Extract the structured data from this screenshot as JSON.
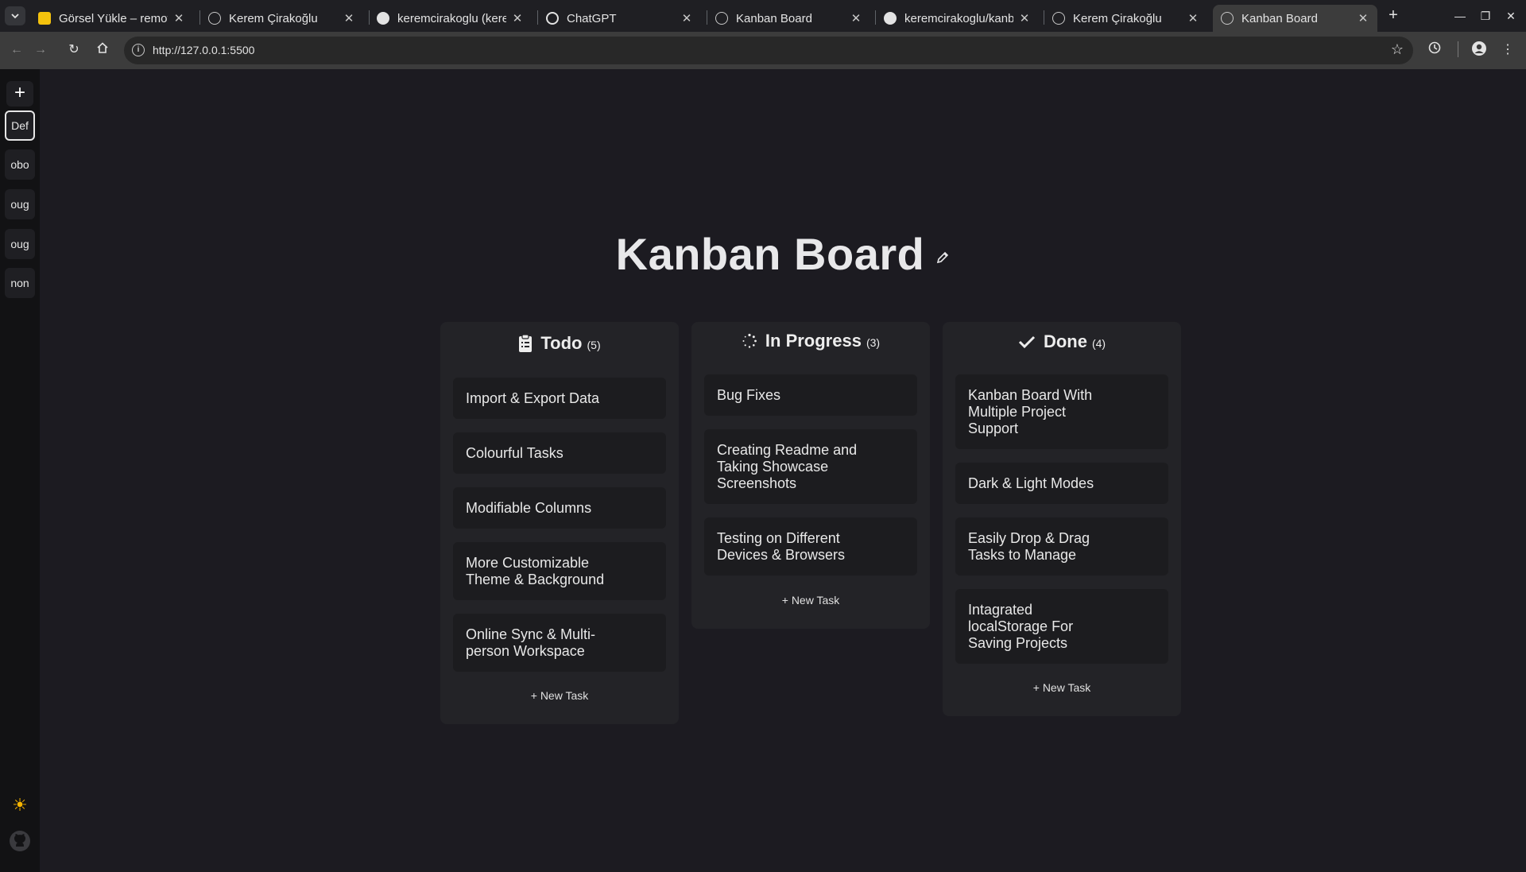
{
  "browser": {
    "tabs": [
      {
        "title": "Görsel Yükle – remove.bg",
        "favicon": "remove-bg-icon",
        "active": false
      },
      {
        "title": "Kerem Çirakoğlu",
        "favicon": "globe-icon",
        "active": false
      },
      {
        "title": "keremcirakoglu (keremcirakoglu)",
        "favicon": "github-icon",
        "active": false
      },
      {
        "title": "ChatGPT",
        "favicon": "chatgpt-icon",
        "active": false
      },
      {
        "title": "Kanban Board",
        "favicon": "globe-icon",
        "active": false
      },
      {
        "title": "keremcirakoglu/kanban",
        "favicon": "github-icon",
        "active": false
      },
      {
        "title": "Kerem Çirakoğlu",
        "favicon": "globe-icon",
        "active": false
      },
      {
        "title": "Kanban Board",
        "favicon": "globe-icon",
        "active": true
      }
    ],
    "url": "http://127.0.0.1:5500"
  },
  "sidebar": {
    "add_label": "+",
    "projects": [
      {
        "label": "Def",
        "active": true
      },
      {
        "label": "obo",
        "active": false
      },
      {
        "label": "oug",
        "active": false
      },
      {
        "label": "oug",
        "active": false
      },
      {
        "label": "non",
        "active": false
      }
    ],
    "theme_icon": "sun-icon",
    "github_icon": "github-icon"
  },
  "board": {
    "title": "Kanban Board",
    "columns": [
      {
        "title": "Todo",
        "count": "(5)",
        "icon": "clipboard-icon",
        "tasks": [
          "Import & Export Data",
          "Colourful Tasks",
          "Modifiable Columns",
          "More Customizable Theme & Background",
          "Online Sync & Multi-person Workspace"
        ],
        "new_task_label": "+ New Task"
      },
      {
        "title": "In Progress",
        "count": "(3)",
        "icon": "spinner-icon",
        "tasks": [
          "Bug Fixes",
          "Creating Readme and Taking Showcase Screenshots",
          "Testing on Different Devices & Browsers"
        ],
        "new_task_label": "+ New Task"
      },
      {
        "title": "Done",
        "count": "(4)",
        "icon": "check-icon",
        "tasks": [
          "Kanban Board With Multiple Project Support",
          "Dark & Light Modes",
          "Easily Drop & Drag Tasks to Manage",
          "Intagrated localStorage For Saving Projects"
        ],
        "new_task_label": "+ New Task"
      }
    ]
  },
  "colors": {
    "background": "#1c1b21",
    "sidebar": "#121214",
    "column": "#232327",
    "card": "#1c1c1f",
    "accent_sun": "#f7b500"
  }
}
